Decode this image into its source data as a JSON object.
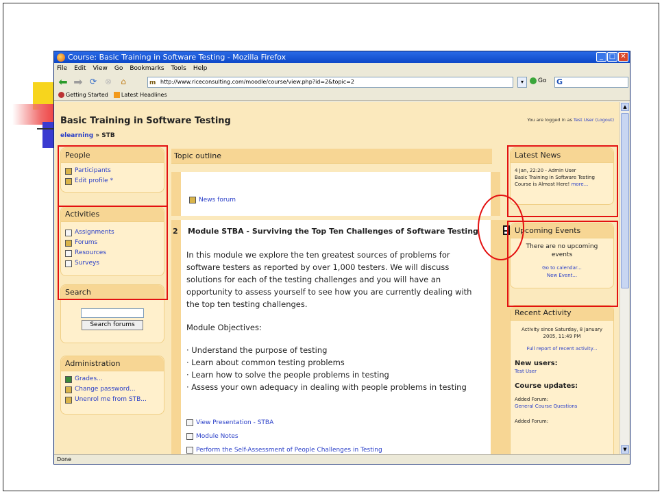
{
  "window": {
    "title": "Course: Basic Training in Software Testing - Mozilla Firefox",
    "controls": [
      "_",
      "□",
      "✕"
    ]
  },
  "menu": [
    "File",
    "Edit",
    "View",
    "Go",
    "Bookmarks",
    "Tools",
    "Help"
  ],
  "nav": {
    "url": "http://www.riceconsulting.com/moodle/course/view.php?id=2&topic=2",
    "go_label": "Go",
    "search_value": "G"
  },
  "bookmarks": [
    "Getting Started",
    "Latest Headlines"
  ],
  "page": {
    "course_title": "Basic Training in Software Testing",
    "logged_prefix": "You are logged in as",
    "logged_user": "Test User",
    "logout": "(Logout)",
    "breadcrumb_home": "elearning",
    "breadcrumb_sep": "»",
    "breadcrumb_current": "STB"
  },
  "blocks": {
    "people": {
      "title": "People",
      "items": [
        "Participants",
        "Edit profile *"
      ]
    },
    "activities": {
      "title": "Activities",
      "items": [
        "Assignments",
        "Forums",
        "Resources",
        "Surveys"
      ]
    },
    "search": {
      "title": "Search",
      "button": "Search forums"
    },
    "administration": {
      "title": "Administration",
      "items": [
        "Grades...",
        "Change password...",
        "Unenrol me from STB..."
      ]
    }
  },
  "topics": {
    "header": "Topic outline",
    "news_forum": "News forum",
    "section": {
      "number": "2",
      "title": "Module STBA - Surviving the Top Ten Challenges of Software Testing",
      "paragraph": "In this module we explore the ten greatest sources of problems for software testers as reported by over 1,000 testers. We will discuss solutions for each of the testing challenges and you will have an opportunity to assess yourself to see how you are currently dealing with the top ten testing challenges.",
      "objectives_heading": "Module Objectives:",
      "objectives": [
        "· Understand the purpose of testing",
        "· Learn about common testing problems",
        "· Learn how to solve the people problems in testing",
        "· Assess your own adequacy in dealing with people problems in testing"
      ],
      "links": [
        "View Presentation - STBA",
        "Module Notes",
        "Perform the Self-Assessment of People Challenges in Testing"
      ]
    }
  },
  "right": {
    "latest_news": {
      "title": "Latest News",
      "date": "4 Jan, 22:20 - Admin User",
      "headline": "Basic Training in Software Testing Course is Almost Here!",
      "more": "more..."
    },
    "upcoming": {
      "title": "Upcoming Events",
      "empty": "There are no upcoming events",
      "calendar": "Go to calendar...",
      "new_event": "New Event..."
    },
    "recent": {
      "title": "Recent Activity",
      "since": "Activity since Saturday, 8 January 2005, 11:49 PM",
      "full_report": "Full report of recent activity...",
      "new_users_h": "New users:",
      "new_user": "Test User",
      "course_updates_h": "Course updates:",
      "added_forum_1": "Added Forum:",
      "forum_1": "General Course Questions",
      "added_forum_2": "Added Forum:"
    }
  },
  "status": "Done",
  "colors": {
    "annotation": "#e31010",
    "block_header": "#f7d694",
    "link": "#2a3fc8"
  }
}
